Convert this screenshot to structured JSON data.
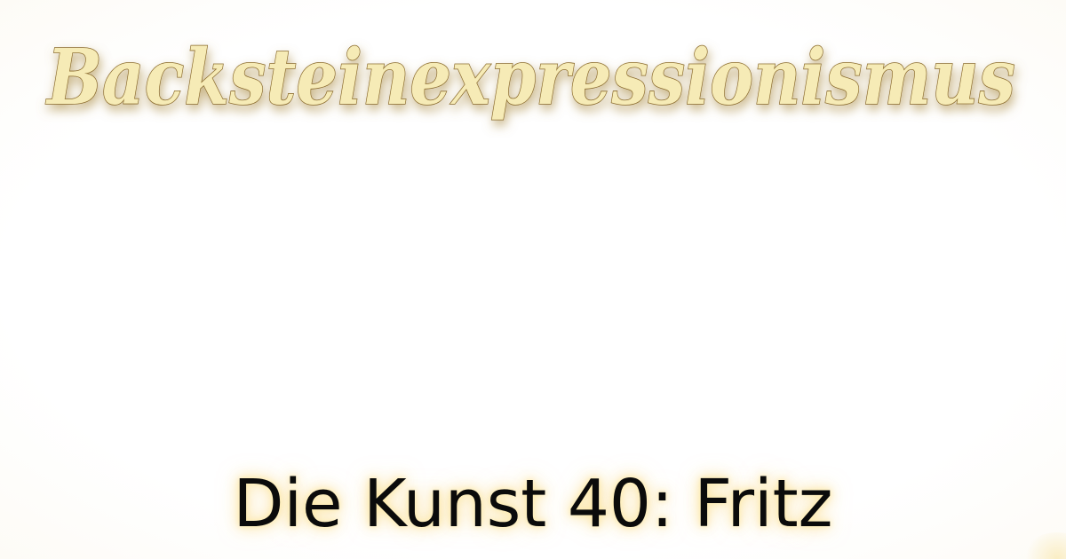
{
  "page": {
    "headline": "Backsteinexpressionismus",
    "subtitle": "Die Kunst 40: Fritz"
  },
  "colors": {
    "headline_fill": "#f6ebb6",
    "headline_stroke": "#8a6a2c",
    "headline_glow": "#b59a5a",
    "subtitle_text": "#0b0b0b",
    "subtitle_glow": "#f8d678",
    "background": "#ffffff"
  }
}
